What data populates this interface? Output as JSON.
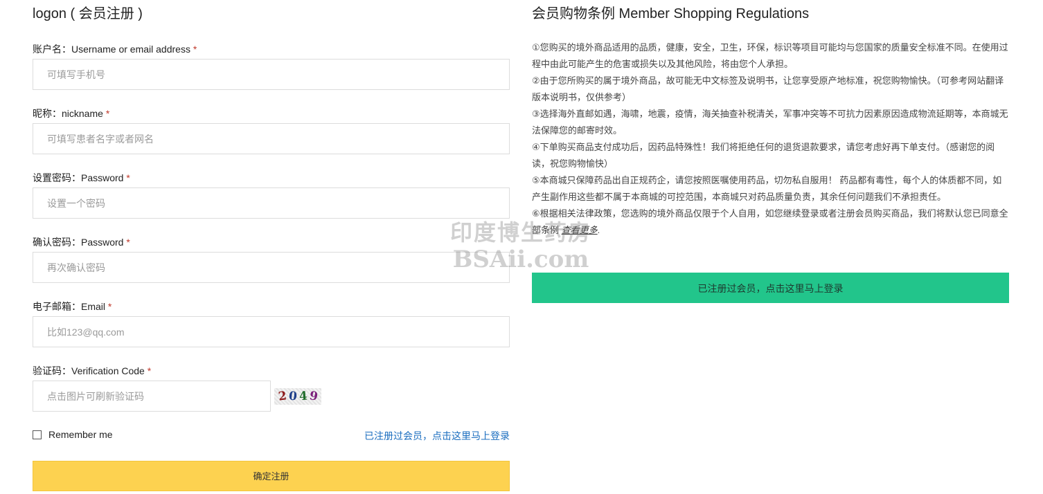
{
  "register": {
    "title": "logon ( 会员注册 )",
    "fields": [
      {
        "label": "账户名：Username or email address",
        "required": "*",
        "placeholder": "可填写手机号"
      },
      {
        "label": "昵称：nickname",
        "required": "*",
        "placeholder": "可填写患者名字或者网名"
      },
      {
        "label": "设置密码：Password",
        "required": "*",
        "placeholder": "设置一个密码"
      },
      {
        "label": "确认密码：Password",
        "required": "*",
        "placeholder": "再次确认密码"
      },
      {
        "label": "电子邮箱：Email",
        "required": "*",
        "placeholder": "比如123@qq.com"
      },
      {
        "label": "验证码：Verification Code",
        "required": "*",
        "placeholder": "点击图片可刷新验证码"
      }
    ],
    "captcha": [
      "2",
      "0",
      "4",
      "9"
    ],
    "remember_label": "Remember me",
    "login_link": "已注册过会员，点击这里马上登录",
    "submit_label": "确定注册"
  },
  "regulations": {
    "title": "会员购物条例 Member Shopping Regulations",
    "items": [
      "①您购买的境外商品适用的品质，健康，安全，卫生，环保，标识等项目可能均与您国家的质量安全标准不同。在使用过程中由此可能产生的危害或损失以及其他风险，将由您个人承担。",
      "②由于您所购买的属于境外商品，故可能无中文标签及说明书，让您享受原产地标准，祝您购物愉快。（可参考网站翻译版本说明书，仅供参考）",
      "③选择海外直邮如遇，海啸，地震，疫情，海关抽查补税清关，军事冲突等不可抗力因素原因造成物流延期等，本商城无法保障您的邮寄时效。",
      "④下单购买商品支付成功后，因药品特殊性！我们将拒绝任何的退货退款要求，请您考虑好再下单支付。（感谢您的阅读，祝您购物愉快）",
      "⑤本商城只保障药品出自正规药企，请您按照医嘱使用药品，切勿私自服用！ 药品都有毒性，每个人的体质都不同，如产生副作用这些都不属于本商城的可控范围，本商城只对药品质量负责，其余任何问题我们不承担责任。",
      "⑥根据相关法律政策，您选购的境外商品仅限于个人自用，如您继续登录或者注册会员购买商品，我们将默认您已同意全部条例"
    ],
    "more_link": "查看更多",
    "more_suffix": ".",
    "login_button": "已注册过会员，点击这里马上登录"
  },
  "watermark": {
    "line1": "印度博生药房",
    "line2": "BSAii.com"
  },
  "colors": {
    "submit_bg": "#fdd250",
    "login_btn_bg": "#22c58b",
    "link": "#1a6dbf",
    "required": "#c0392b"
  }
}
